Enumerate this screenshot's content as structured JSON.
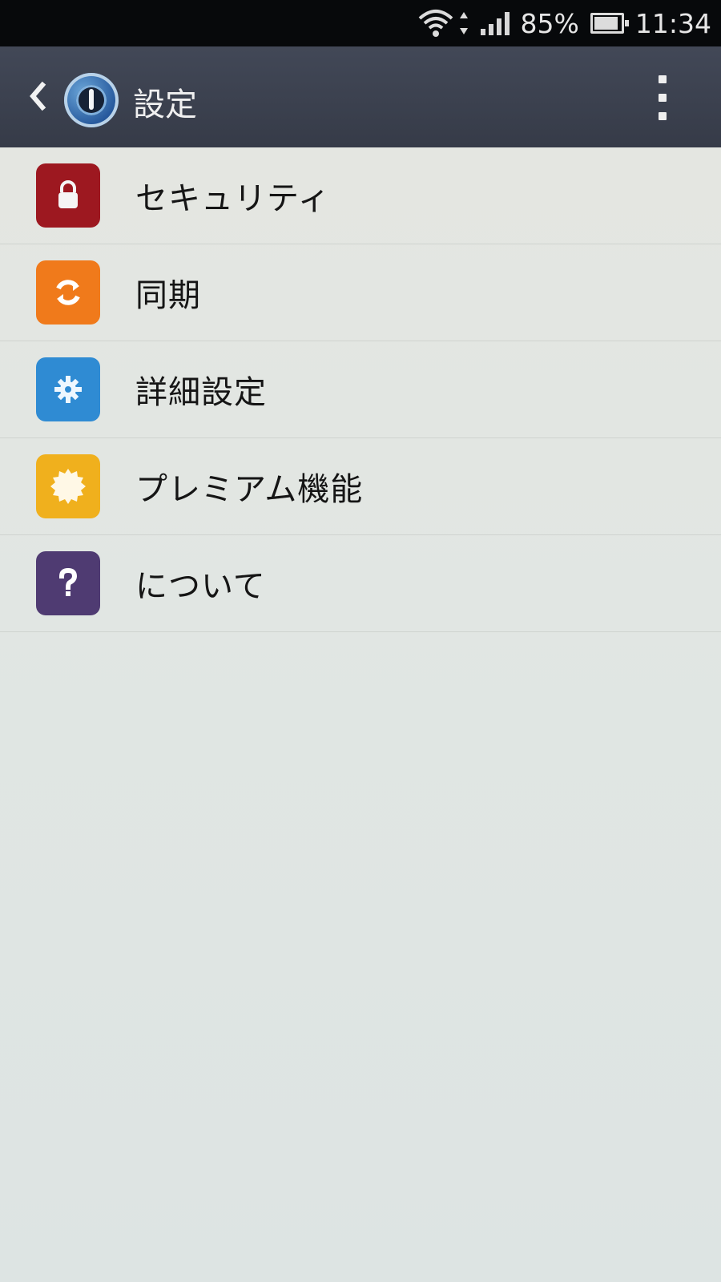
{
  "status_bar": {
    "battery_percent": "85%",
    "time": "11:34",
    "icons": [
      "wifi-icon",
      "data-arrows-icon",
      "signal-icon",
      "battery-icon"
    ]
  },
  "app_bar": {
    "title": "設定",
    "icons": [
      "back-icon",
      "app-logo-icon",
      "overflow-menu-icon"
    ]
  },
  "settings": {
    "items": [
      {
        "label": "セキュリティ",
        "icon": "lock-icon",
        "color": "#9d1820"
      },
      {
        "label": "同期",
        "icon": "sync-icon",
        "color": "#f07a1b"
      },
      {
        "label": "詳細設定",
        "icon": "gear-icon",
        "color": "#2f8bd3"
      },
      {
        "label": "プレミアム機能",
        "icon": "premium-badge-icon",
        "color": "#f0b01d"
      },
      {
        "label": "について",
        "icon": "help-icon",
        "color": "#4f3b72"
      }
    ]
  }
}
